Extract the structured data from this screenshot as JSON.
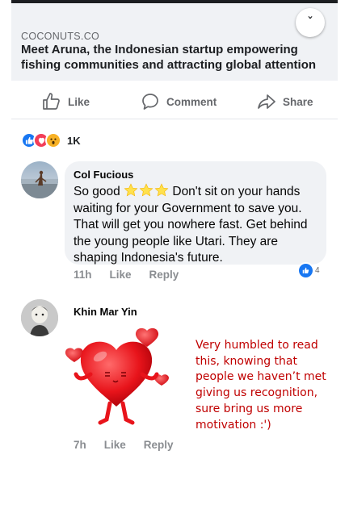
{
  "link_card": {
    "source": "COCONUTS.CO",
    "title": "Meet Aruna, the Indonesian startup empowering fishing communities and attracting global attention"
  },
  "actions": {
    "like": "Like",
    "comment": "Comment",
    "share": "Share"
  },
  "reactions": {
    "icons": [
      "like-icon",
      "love-icon",
      "wow-icon"
    ],
    "count": "1K"
  },
  "comments": [
    {
      "author": "Col Fucious",
      "text_prefix": "So good",
      "emojis": [
        "star-emoji",
        "star-emoji",
        "star-emoji"
      ],
      "text_suffix": " Don't sit on your hands waiting for your Government to save you. That will get you nowhere fast. Get behind the young people like Utari. They are shaping Indonesia's future.",
      "time": "11h",
      "like_label": "Like",
      "reply_label": "Reply",
      "like_count": "4"
    },
    {
      "author": "Khin Mar Yin",
      "sticker": "heart-sticker",
      "time": "7h",
      "like_label": "Like",
      "reply_label": "Reply"
    }
  ],
  "annotation": "Very humbled to read this, knowing that people we haven’t met giving us recognition, sure bring us more motivation :')",
  "colors": {
    "accent": "#1877f2",
    "love": "#f33e58",
    "wow": "#f7b125",
    "annotation": "#c00000",
    "bubble": "#f0f2f5"
  }
}
